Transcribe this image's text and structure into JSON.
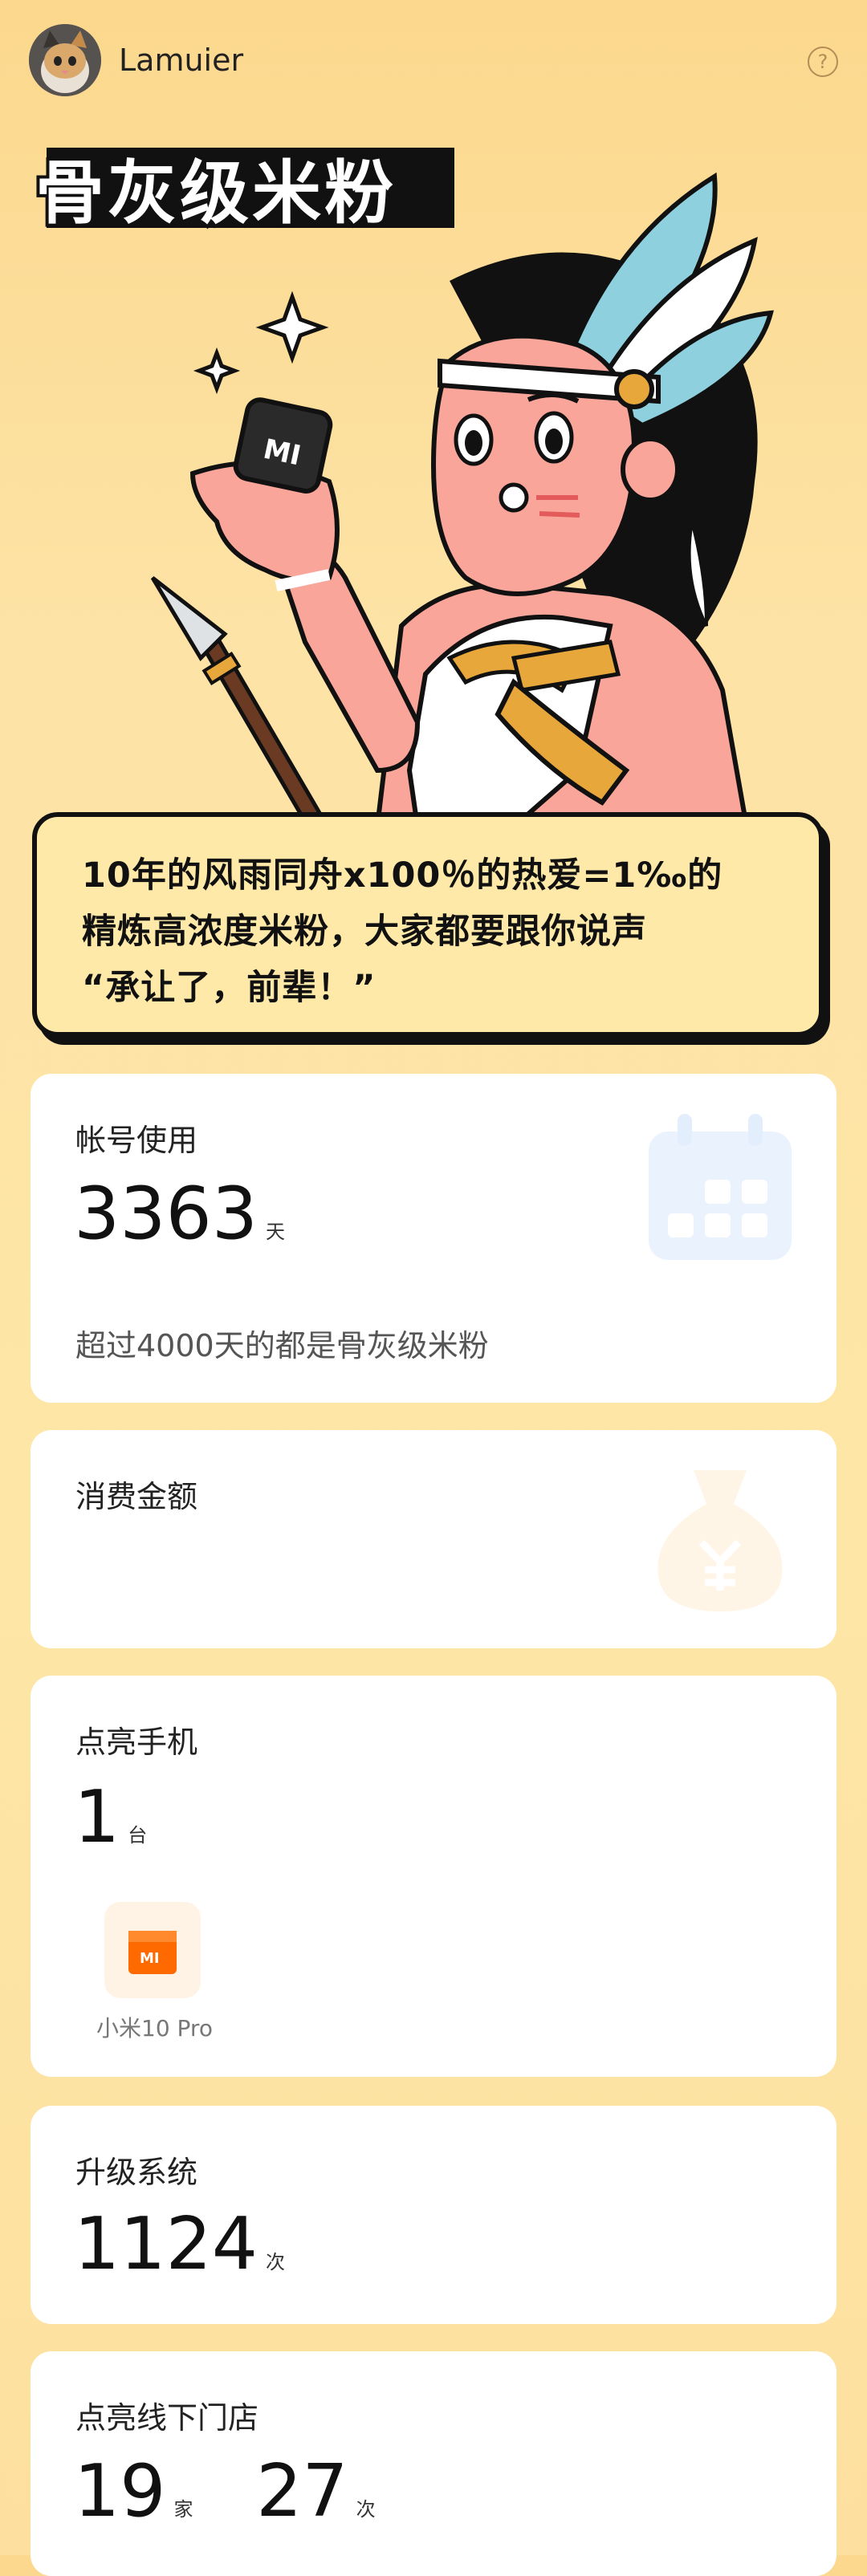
{
  "user": {
    "name": "Lamuier"
  },
  "header": {
    "help_icon": "?"
  },
  "title": "骨灰级米粉",
  "hero": {
    "phone_logo": "MI"
  },
  "speech": {
    "line1": "10年的风雨同舟x100％的热爱=1‰的",
    "line2": "精炼高浓度米粉，大家都要跟你说声",
    "line3": "“承让了，前辈！”"
  },
  "cards": {
    "account": {
      "label": "帐号使用",
      "value": "3363",
      "unit": "天",
      "note": "超过4000天的都是骨灰级米粉"
    },
    "spend": {
      "label": "消费金额"
    },
    "phones": {
      "label": "点亮手机",
      "value": "1",
      "unit": "台",
      "device_name": "小米10 Pro",
      "device_logo": "MI"
    },
    "upgrade": {
      "label": "升级系统",
      "value": "1124",
      "unit": "次"
    },
    "stores": {
      "label": "点亮线下门店",
      "value1": "19",
      "unit1": "家",
      "value2": "27",
      "unit2": "次"
    }
  },
  "colors": {
    "accent": "#ff6a00",
    "card_bg": "#ffffff",
    "page_bg": "#fde3a6"
  }
}
